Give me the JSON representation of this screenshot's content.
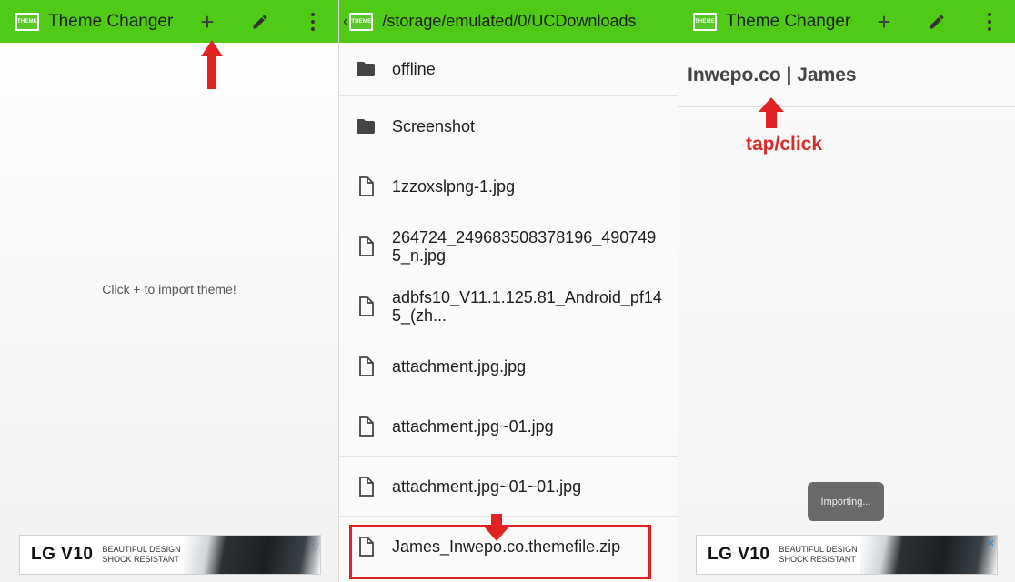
{
  "panel1": {
    "logo_text": "THEME",
    "title": "Theme Changer",
    "empty_message": "Click + to import theme!",
    "ad": {
      "brand": "LG V10",
      "tagline_1": "BEAUTIFUL DESIGN",
      "tagline_2": "SHOCK RESISTANT"
    }
  },
  "panel2": {
    "logo_text": "THEME",
    "path": "/storage/emulated/0/UCDownloads",
    "items": [
      {
        "name": "offline",
        "type": "folder"
      },
      {
        "name": "Screenshot",
        "type": "folder"
      },
      {
        "name": "1zzoxslpng-1.jpg",
        "type": "file"
      },
      {
        "name": "264724_249683508378196_4907495_n.jpg",
        "type": "file"
      },
      {
        "name": "adbfs10_V11.1.125.81_Android_pf145_(zh...",
        "type": "file"
      },
      {
        "name": "attachment.jpg.jpg",
        "type": "file"
      },
      {
        "name": "attachment.jpg~01.jpg",
        "type": "file"
      },
      {
        "name": "attachment.jpg~01~01.jpg",
        "type": "file"
      },
      {
        "name": "James_Inwepo.co.themefile.zip",
        "type": "file"
      }
    ]
  },
  "panel3": {
    "logo_text": "THEME",
    "title": "Theme Changer",
    "theme_name": "Inwepo.co | James",
    "annotation": "tap/click",
    "toast": "Importing...",
    "ad": {
      "brand": "LG V10",
      "tagline_1": "BEAUTIFUL DESIGN",
      "tagline_2": "SHOCK RESISTANT"
    }
  },
  "colors": {
    "appbar": "#4fcb17",
    "annotation_red": "#e02222"
  },
  "icons": [
    "plus-icon",
    "pencil-icon",
    "overflow-menu-icon",
    "folder-icon",
    "file-icon",
    "chevron-left-icon",
    "red-arrow-icon"
  ]
}
